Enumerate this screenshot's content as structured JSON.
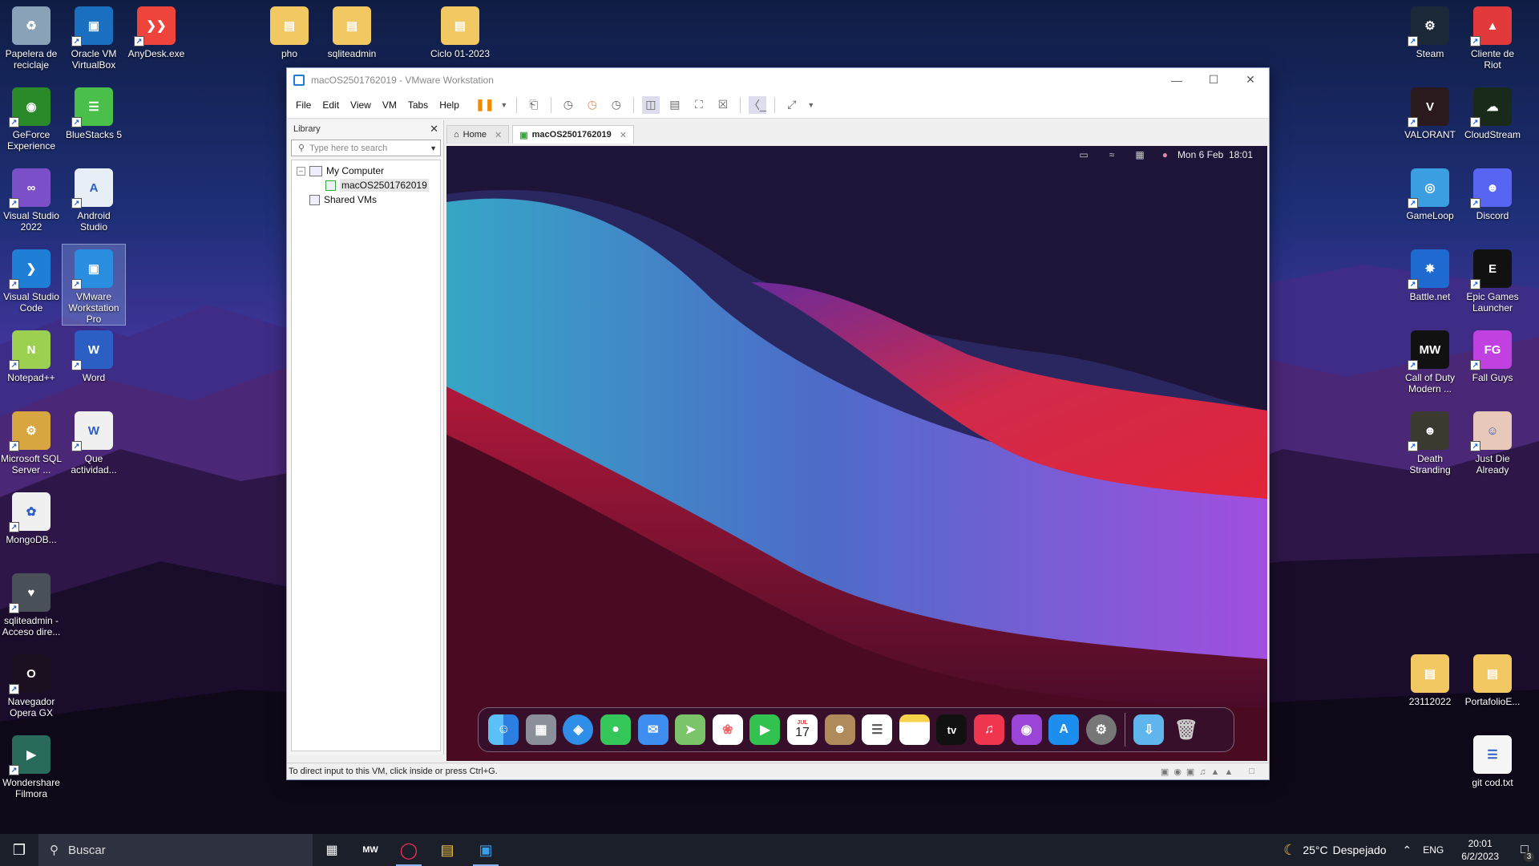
{
  "desktop_icons_left": [
    {
      "label": "Papelera de reciclaje",
      "icon": "recycle-bin-icon"
    },
    {
      "label": "Oracle VM VirtualBox",
      "icon": "virtualbox-icon"
    },
    {
      "label": "AnyDesk.exe",
      "icon": "anydesk-icon"
    },
    {
      "label": "pho",
      "icon": "folder-icon"
    },
    {
      "label": "sqliteadmin",
      "icon": "folder-icon"
    },
    {
      "label": "Ciclo 01-2023",
      "icon": "folder-icon"
    },
    {
      "label": "GeForce Experience",
      "icon": "geforce-icon"
    },
    {
      "label": "BlueStacks 5",
      "icon": "bluestacks-icon"
    },
    {
      "label": "Visual Studio 2022",
      "icon": "visual-studio-icon"
    },
    {
      "label": "Android Studio",
      "icon": "android-studio-icon"
    },
    {
      "label": "Visual Studio Code",
      "icon": "vscode-icon"
    },
    {
      "label": "VMware Workstation Pro",
      "icon": "vmware-icon"
    },
    {
      "label": "Notepad++",
      "icon": "notepadpp-icon"
    },
    {
      "label": "Word",
      "icon": "word-icon"
    },
    {
      "label": "Microsoft SQL Server ...",
      "icon": "sql-server-icon"
    },
    {
      "label": "Que actividad...",
      "icon": "word-doc-icon"
    },
    {
      "label": "MongoDB...",
      "icon": "mongodb-icon"
    },
    {
      "label": "sqliteadmin - Acceso dire...",
      "icon": "sqliteadmin-icon"
    },
    {
      "label": "Navegador Opera GX",
      "icon": "opera-gx-icon"
    },
    {
      "label": "Wondershare Filmora",
      "icon": "filmora-icon"
    }
  ],
  "desktop_icons_right": [
    {
      "label": "Steam",
      "icon": "steam-icon"
    },
    {
      "label": "Cliente de Riot",
      "icon": "riot-icon"
    },
    {
      "label": "VALORANT",
      "icon": "valorant-icon"
    },
    {
      "label": "CloudStream",
      "icon": "cloudstream-icon"
    },
    {
      "label": "GameLoop",
      "icon": "gameloop-icon"
    },
    {
      "label": "Discord",
      "icon": "discord-icon"
    },
    {
      "label": "Battle.net",
      "icon": "battlenet-icon"
    },
    {
      "label": "Epic Games Launcher",
      "icon": "epic-games-icon"
    },
    {
      "label": "Call of Duty Modern ...",
      "icon": "cod-icon"
    },
    {
      "label": "Fall Guys",
      "icon": "fall-guys-icon"
    },
    {
      "label": "Death Stranding",
      "icon": "death-stranding-icon"
    },
    {
      "label": "Just Die Already",
      "icon": "just-die-already-icon"
    },
    {
      "label": "23112022",
      "icon": "folder-icon"
    },
    {
      "label": "PortafolioE...",
      "icon": "folder-icon"
    },
    {
      "label": "git cod.txt",
      "icon": "text-file-icon"
    }
  ],
  "window": {
    "title": "macOS2501762019 - VMware Workstation",
    "menu": [
      "File",
      "Edit",
      "View",
      "VM",
      "Tabs",
      "Help"
    ],
    "library_title": "Library",
    "search_placeholder": "Type here to search",
    "tree": {
      "root": "My Computer",
      "vm": "macOS2501762019",
      "shared": "Shared VMs"
    },
    "tabs": [
      {
        "label": "Home"
      },
      {
        "label": "macOS2501762019"
      }
    ],
    "status": "To direct input to this VM, click inside or press Ctrl+G."
  },
  "guest": {
    "clock": "Mon 6 Feb  18:01",
    "calendar_month": "JUL",
    "calendar_day": "17",
    "tv_label": "tv"
  },
  "taskbar": {
    "search_placeholder": "Buscar",
    "weather_temp": "25°C",
    "weather_desc": "Despejado",
    "lang": "ENG",
    "time": "20:01",
    "date": "6/2/2023",
    "notifications": "3"
  }
}
